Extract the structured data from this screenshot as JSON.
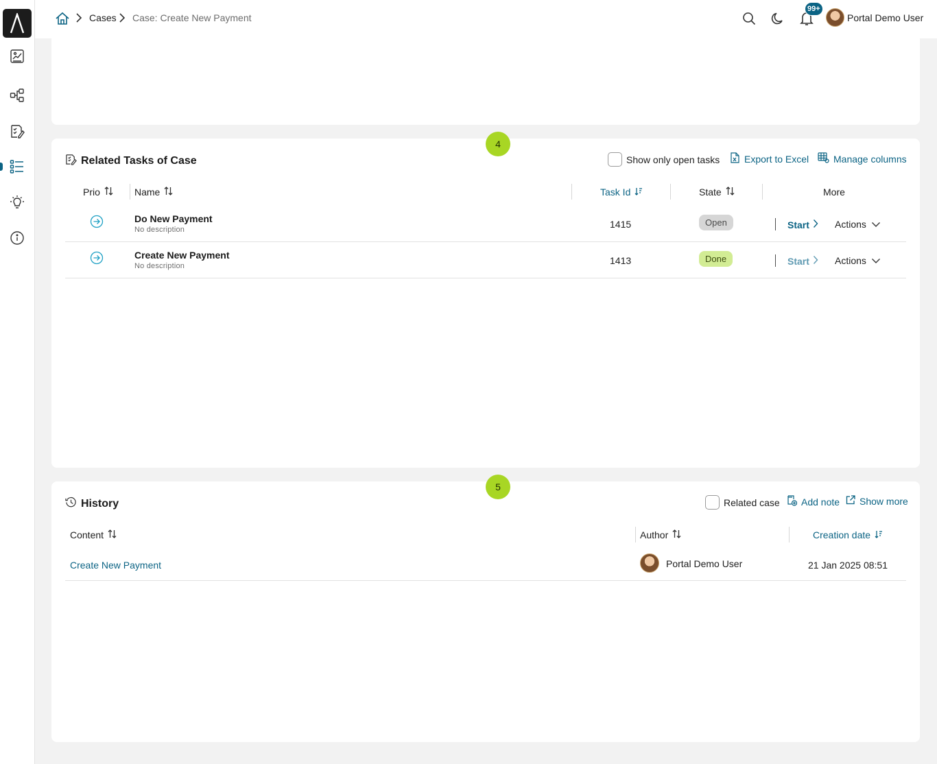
{
  "breadcrumb": {
    "items": [
      "Cases",
      "Case: Create New Payment"
    ]
  },
  "header": {
    "notification_count": "99+",
    "user_name": "Portal Demo User"
  },
  "sidebar": {
    "items": [
      "dashboard-icon",
      "processes-icon",
      "tasks-icon",
      "cases-icon",
      "statistics-icon",
      "info-icon"
    ],
    "active": "cases-icon"
  },
  "tasks_section": {
    "step": "4",
    "title": "Related Tasks of Case",
    "show_open_label": "Show only open tasks",
    "export_label": "Export to Excel",
    "manage_columns_label": "Manage columns",
    "columns": {
      "prio": "Prio",
      "name": "Name",
      "task_id": "Task Id",
      "state": "State",
      "more": "More"
    },
    "rows": [
      {
        "name": "Do New Payment",
        "description": "No description",
        "task_id": "1415",
        "state": "Open",
        "start": "Start",
        "actions": "Actions"
      },
      {
        "name": "Create New Payment",
        "description": "No description",
        "task_id": "1413",
        "state": "Done",
        "start": "Start",
        "actions": "Actions"
      }
    ]
  },
  "history_section": {
    "step": "5",
    "title": "History",
    "related_case_label": "Related case",
    "add_note_label": "Add note",
    "show_more_label": "Show more",
    "columns": {
      "content": "Content",
      "author": "Author",
      "creation_date": "Creation date"
    },
    "rows": [
      {
        "content": "Create New Payment",
        "author": "Portal Demo User",
        "creation_date": "21 Jan 2025 08:51"
      }
    ]
  },
  "colors": {
    "accent": "#0b6384",
    "step_badge": "#a8d624",
    "state_open": "#d6d6d6",
    "state_done": "#d2ec94"
  }
}
